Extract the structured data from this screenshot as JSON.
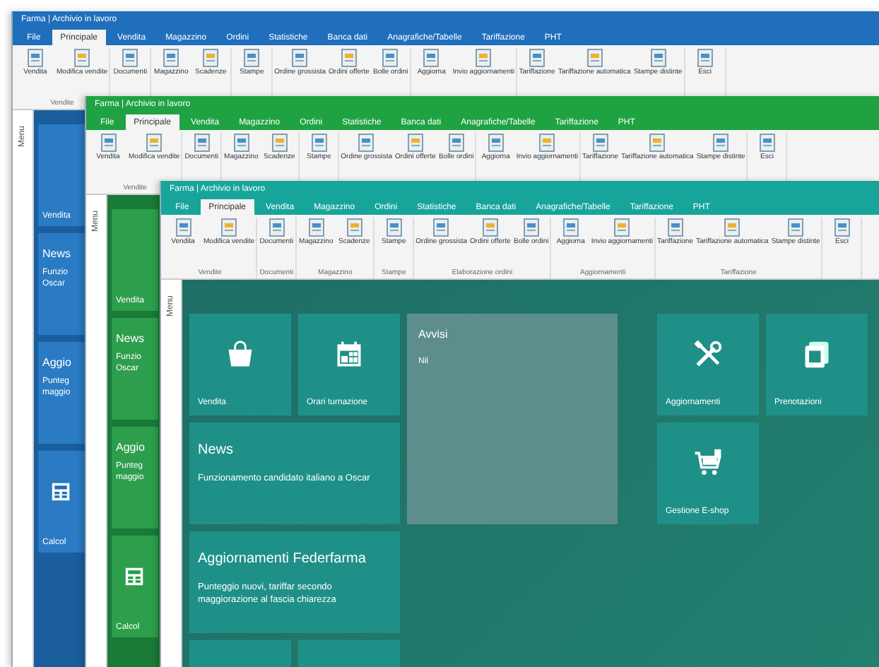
{
  "windows": [
    {
      "color": "#1f6fbd",
      "title": "Farma | Archivio in lavoro",
      "tabs": [
        {
          "label": "File",
          "selected": false
        },
        {
          "label": "Principale",
          "selected": true
        },
        {
          "label": "Vendita",
          "selected": false
        },
        {
          "label": "Magazzino",
          "selected": false
        },
        {
          "label": "Ordini",
          "selected": false
        },
        {
          "label": "Statistiche",
          "selected": false
        },
        {
          "label": "Banca dati",
          "selected": false
        },
        {
          "label": "Anagrafiche/Tabelle",
          "selected": false
        },
        {
          "label": "Tariffazione",
          "selected": false
        },
        {
          "label": "PHT",
          "selected": false
        }
      ],
      "groups": [
        {
          "label": "Vendite",
          "items": [
            "Vendita",
            "Modifica vendite"
          ]
        },
        {
          "items": [
            "Documenti"
          ]
        },
        {
          "items": [
            "Magazzino",
            "Scadenze"
          ]
        },
        {
          "items": [
            "Stampe"
          ]
        },
        {
          "items": [
            "Ordine grossista",
            "Ordini offerte",
            "Bolle ordini"
          ]
        },
        {
          "items": [
            "Aggiorna",
            "Invio aggiornamenti"
          ]
        },
        {
          "items": [
            "Tariffazione",
            "Tariffazione automatica",
            "Stampe distinte"
          ]
        },
        {
          "items": [
            "Esci"
          ]
        }
      ],
      "sidebar_label": "Menu",
      "strip_tiles": [
        {
          "kind": "label",
          "title": "Vendita"
        },
        {
          "kind": "text",
          "title": "News",
          "lines": [
            "Funzio",
            "Oscar"
          ]
        },
        {
          "kind": "text",
          "title": "Aggio",
          "lines": [
            "Punteg",
            "maggio"
          ]
        },
        {
          "kind": "calculator",
          "title": "Calcol"
        }
      ]
    },
    {
      "color": "#1fa342",
      "title": "Farma | Archivio in lavoro",
      "tabs": [
        {
          "label": "File",
          "selected": false
        },
        {
          "label": "Principale",
          "selected": true
        },
        {
          "label": "Vendita",
          "selected": false
        },
        {
          "label": "Magazzino",
          "selected": false
        },
        {
          "label": "Ordini",
          "selected": false
        },
        {
          "label": "Statistiche",
          "selected": false
        },
        {
          "label": "Banca dati",
          "selected": false
        },
        {
          "label": "Anagrafiche/Tabelle",
          "selected": false
        },
        {
          "label": "Tariffazione",
          "selected": false
        },
        {
          "label": "PHT",
          "selected": false
        }
      ],
      "groups": [
        {
          "label": "Vendite",
          "items": [
            "Vendita",
            "Modifica vendite"
          ]
        },
        {
          "items": [
            "Documenti"
          ]
        },
        {
          "items": [
            "Magazzino",
            "Scadenze"
          ]
        },
        {
          "items": [
            "Stampe"
          ]
        },
        {
          "items": [
            "Ordine grossista",
            "Ordini offerte",
            "Bolle ordini"
          ]
        },
        {
          "items": [
            "Aggiorna",
            "Invio aggiornamenti"
          ]
        },
        {
          "items": [
            "Tariffazione",
            "Tariffazione automatica",
            "Stampe distinte"
          ]
        },
        {
          "items": [
            "Esci"
          ]
        }
      ],
      "sidebar_label": "Menu",
      "strip_tiles": [
        {
          "kind": "label",
          "title": "Vendita"
        },
        {
          "kind": "text",
          "title": "News",
          "lines": [
            "Funzio",
            "Oscar"
          ]
        },
        {
          "kind": "text",
          "title": "Aggio",
          "lines": [
            "Punteg",
            "maggio"
          ]
        },
        {
          "kind": "calculator",
          "title": "Calcol"
        }
      ]
    },
    {
      "color": "#17a59b",
      "title": "Farma | Archivio in lavoro",
      "tabs": [
        {
          "label": "File",
          "selected": false
        },
        {
          "label": "Principale",
          "selected": true
        },
        {
          "label": "Vendita",
          "selected": false
        },
        {
          "label": "Magazzino",
          "selected": false
        },
        {
          "label": "Ordini",
          "selected": false
        },
        {
          "label": "Statistiche",
          "selected": false
        },
        {
          "label": "Banca dati",
          "selected": false
        },
        {
          "label": "Anagrafiche/Tabelle",
          "selected": false
        },
        {
          "label": "Tariffazione",
          "selected": false
        },
        {
          "label": "PHT",
          "selected": false
        }
      ],
      "groups": [
        {
          "label": "Vendite",
          "items": [
            "Vendita",
            "Modifica vendite"
          ]
        },
        {
          "label": "Documenti",
          "items": [
            "Documenti"
          ]
        },
        {
          "label": "Magazzino",
          "items": [
            "Magazzino",
            "Scadenze"
          ]
        },
        {
          "label": "Stampe",
          "items": [
            "Stampe"
          ]
        },
        {
          "label": "Elaborazione ordini",
          "items": [
            "Ordine grossista",
            "Ordini offerte",
            "Bolle ordini"
          ]
        },
        {
          "label": "Aggiornamenti",
          "items": [
            "Aggiorna",
            "Invio aggiornamenti"
          ]
        },
        {
          "label": "Tariffazione",
          "items": [
            "Tariffazione",
            "Tariffazione automatica",
            "Stampe distinte"
          ]
        },
        {
          "items": [
            "Esci"
          ]
        }
      ],
      "sidebar_label": "Menu",
      "tiles_left": [
        {
          "kind": "shop",
          "label": "Vendita"
        },
        {
          "kind": "calendar",
          "label": "Orari turnazione"
        },
        {
          "kind": "text",
          "title": "News",
          "text": "Funzionamento candidato italiano a Oscar"
        },
        {
          "kind": "text",
          "title": "Aggiornamenti Federfarma",
          "text": "Punteggio nuovi, tariffar secondo maggiorazione al fascia chiarezza"
        },
        {
          "kind": "blank"
        },
        {
          "kind": "blank"
        }
      ],
      "notice": {
        "title": "Avvisi",
        "text": "Nil"
      },
      "tiles_right": [
        {
          "kind": "tools",
          "label": "Aggiornamenti"
        },
        {
          "kind": "documents",
          "label": "Prenotazioni"
        },
        {
          "kind": "cart",
          "label": "Gestione E-shop"
        }
      ]
    }
  ]
}
